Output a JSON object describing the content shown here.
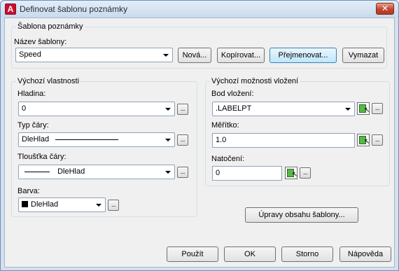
{
  "window": {
    "title": "Definovat šablonu poznámky",
    "close_glyph": "✕"
  },
  "template_group": {
    "title": "Šablona poznámky",
    "name_label": "Název šablony:",
    "name_value": "Speed",
    "buttons": {
      "new": "Nová...",
      "copy": "Kopírovat...",
      "rename": "Přejmenovat...",
      "delete": "Vymazat"
    }
  },
  "defaults_group": {
    "title": "Výchozí vlastnosti",
    "layer_label": "Hladina:",
    "layer_value": "0",
    "linetype_label": "Typ čáry:",
    "linetype_value": "DleHlad",
    "lineweight_label": "Tloušťka čáry:",
    "lineweight_value": "DleHlad",
    "color_label": "Barva:",
    "color_value": "DleHlad",
    "ellipsis": "..."
  },
  "insert_group": {
    "title": "Výchozí možnosti vložení",
    "insertion_point_label": "Bod vložení:",
    "insertion_point_value": ".LABELPT",
    "scale_label": "Měřítko:",
    "scale_value": "1.0",
    "rotation_label": "Natočení:",
    "rotation_value": "0",
    "edit_content_button": "Úpravy obsahu šablony...",
    "cursor_glyph": "↖"
  },
  "footer": {
    "apply": "Použít",
    "ok": "OK",
    "cancel": "Storno",
    "help": "Nápověda"
  },
  "colors": {
    "accent": "#3c7fb1",
    "title_bg": "#c9daee",
    "color_swatch": "#000000",
    "close_red": "#c2452f"
  },
  "icons": {
    "app": "autocad-app-icon",
    "pick": "pick-point-icon"
  }
}
